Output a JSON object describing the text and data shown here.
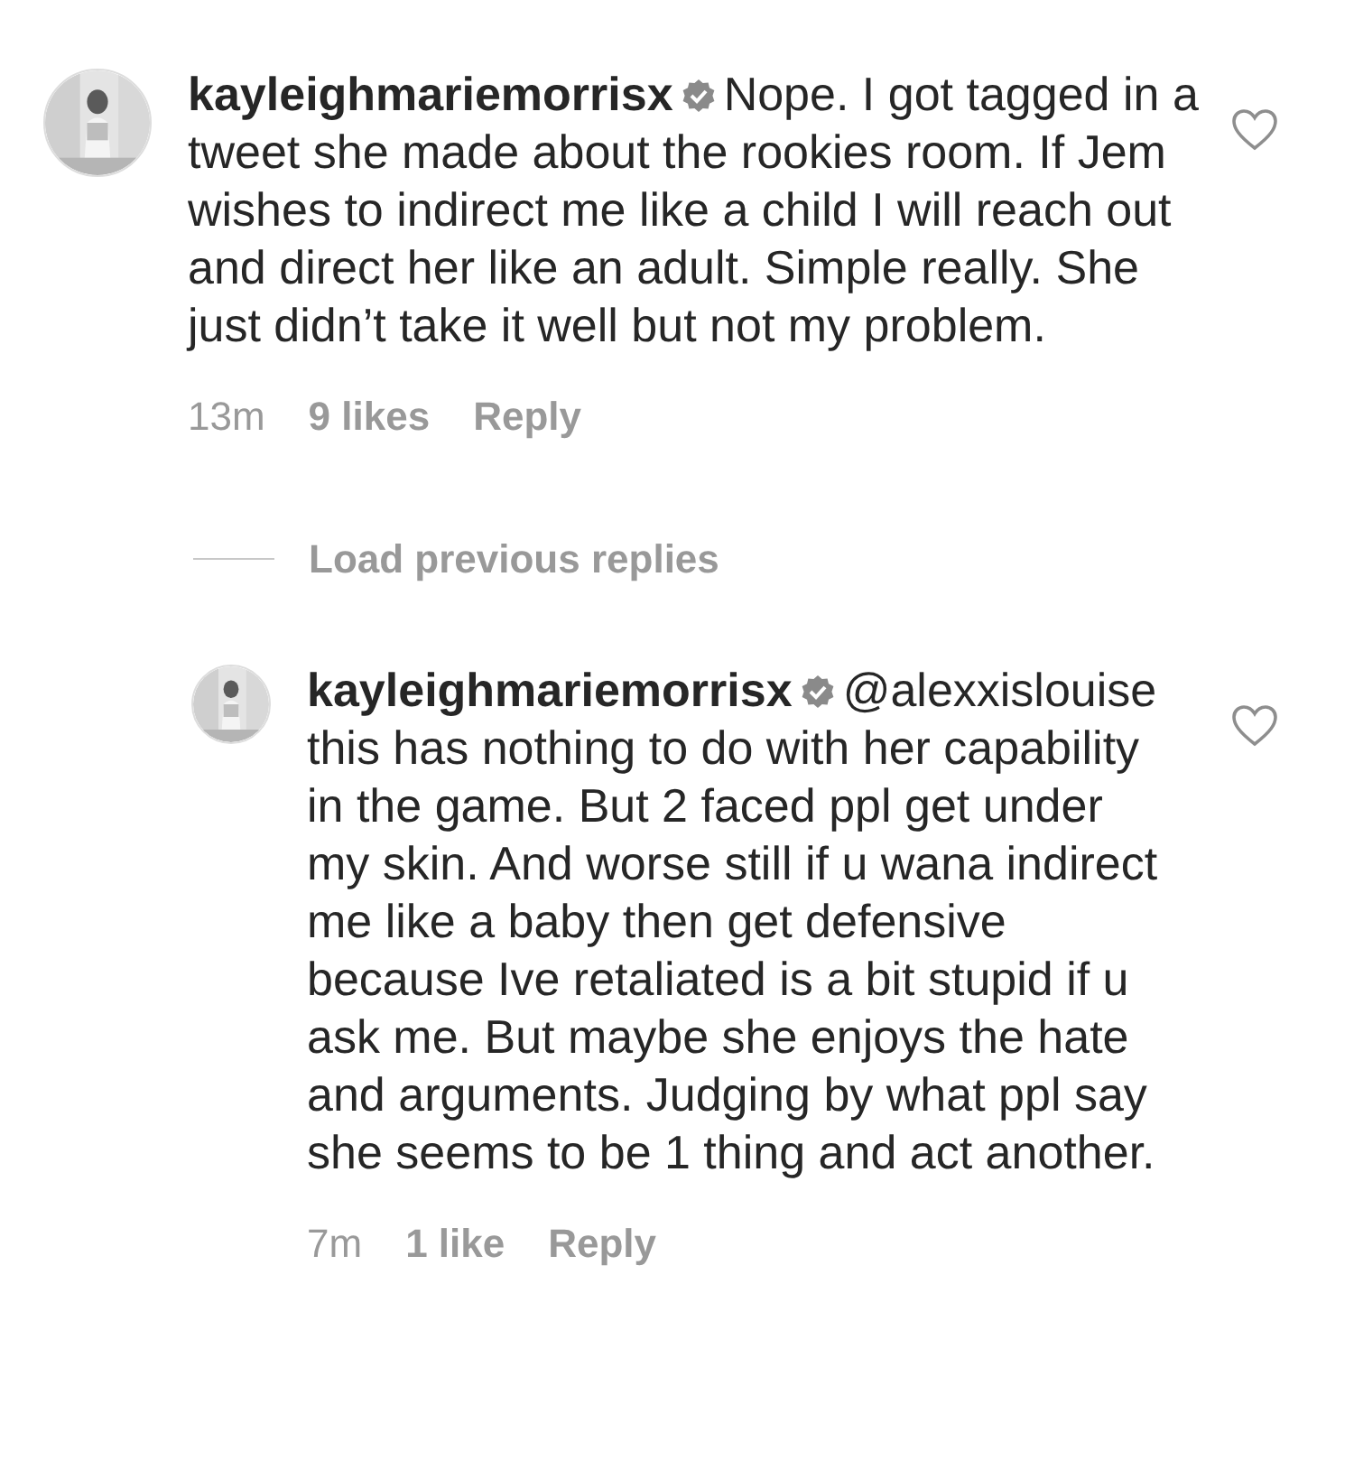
{
  "comments": [
    {
      "username": "kayleighmariemorrisx",
      "verified": true,
      "text": "Nope. I got tagged in a tweet she made about the rookies room. If Jem wishes to indirect me like a child I will reach out and direct her like an adult. Simple really. She just didn’t take it well but not my problem.",
      "liked": false,
      "time": "13m",
      "likes": "9 likes",
      "reply": "Reply"
    }
  ],
  "load_previous": "Load previous replies",
  "replies": [
    {
      "username": "kayleighmariemorrisx",
      "verified": true,
      "text": "@alexxislouise this has nothing to do with her capability in the game. But 2 faced ppl get under my skin. And worse still if u wana indirect me like a baby then get defensive because Ive retaliated is a bit stupid if u ask me. But maybe she enjoys the hate and arguments. Judging by what ppl say she seems to be 1 thing and act another.",
      "liked": false,
      "time": "7m",
      "likes": "1 like",
      "reply": "Reply"
    }
  ]
}
